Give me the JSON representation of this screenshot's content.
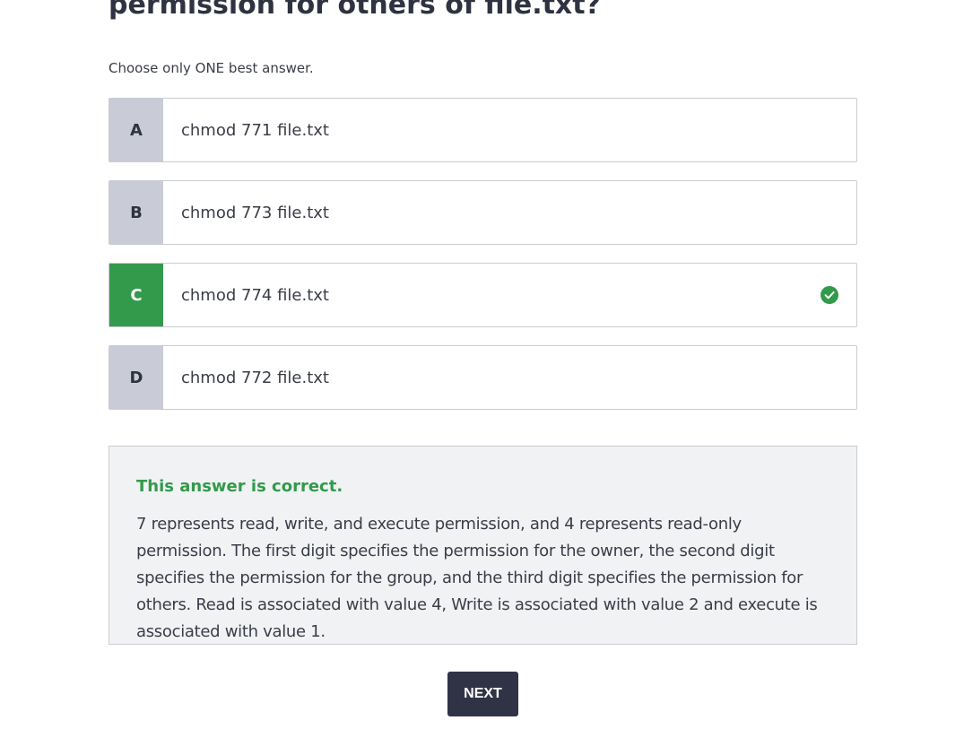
{
  "question": {
    "title_visible": "permission for others of file.txt?",
    "instruction": "Choose only ONE best answer."
  },
  "options": [
    {
      "letter": "A",
      "text": "chmod 771 file.txt",
      "state": "default"
    },
    {
      "letter": "B",
      "text": "chmod 773 file.txt",
      "state": "default"
    },
    {
      "letter": "C",
      "text": "chmod 774 file.txt",
      "state": "correct"
    },
    {
      "letter": "D",
      "text": "chmod 772 file.txt",
      "state": "default"
    }
  ],
  "feedback": {
    "status": "This answer is correct.",
    "explanation": "7 represents read, write, and execute permission, and 4 represents read-only permission. The first digit specifies the permission for the owner, the second digit specifies the permission for the group, and the third digit specifies the permission for others. Read is associated with value 4, Write is associated with value 2 and execute is associated with value 1."
  },
  "actions": {
    "next_label": "NEXT"
  },
  "colors": {
    "correct": "#339a4c",
    "letter_default_bg": "#c9ccd6",
    "feedback_bg": "#f1f2f4",
    "button_bg": "#303345"
  },
  "icons": {
    "correct_marker": "check-circle-icon"
  }
}
